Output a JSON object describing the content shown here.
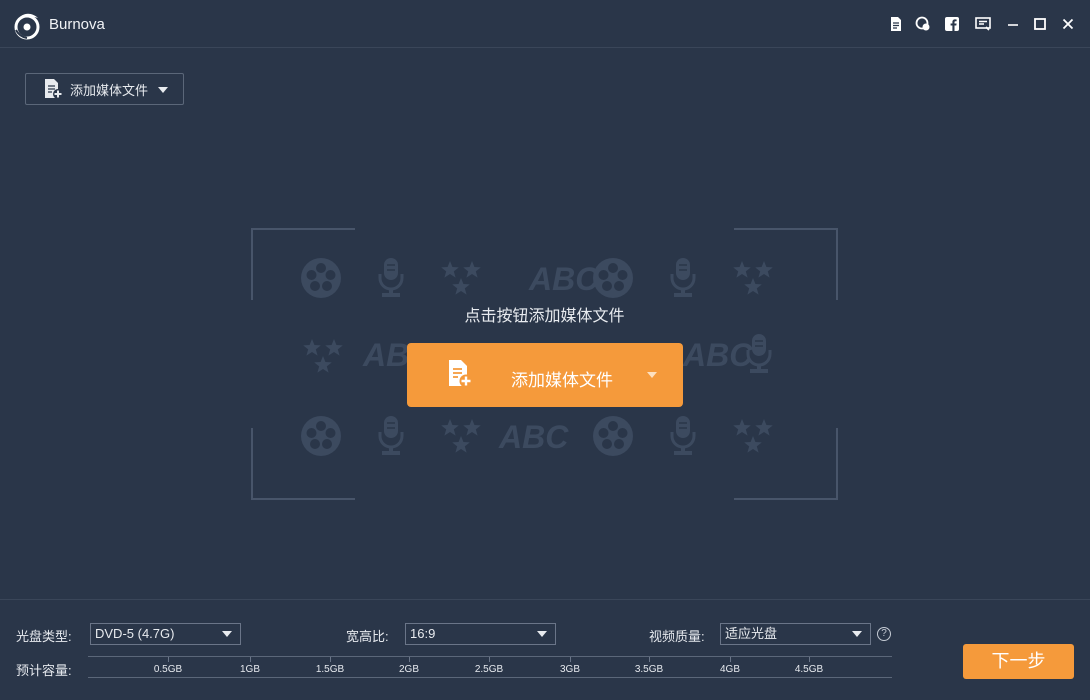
{
  "app": {
    "title": "Burnova"
  },
  "colors": {
    "background": "#2a3649",
    "accent": "#f59a3b",
    "pattern": "#3c4a5f"
  },
  "toolbar": {
    "icons": [
      "document-icon",
      "feedback-icon",
      "facebook-icon",
      "register-icon",
      "minimize-icon",
      "maximize-icon",
      "close-icon"
    ]
  },
  "add_media": {
    "label": "添加媒体文件"
  },
  "drop_zone": {
    "prompt": "点击按钮添加媒体文件",
    "button_label": "添加媒体文件",
    "pattern_text": "ABC"
  },
  "settings": {
    "disc_type": {
      "label": "光盘类型:",
      "value": "DVD-5 (4.7G)"
    },
    "aspect_ratio": {
      "label": "宽高比:",
      "value": "16:9"
    },
    "video_quality": {
      "label": "视频质量:",
      "value": "适应光盘"
    },
    "help": "?"
  },
  "capacity": {
    "label": "预计容量:",
    "ticks": [
      "0.5GB",
      "1GB",
      "1.5GB",
      "2GB",
      "2.5GB",
      "3GB",
      "3.5GB",
      "4GB",
      "4.5GB"
    ]
  },
  "next_button": {
    "label": "下一步"
  }
}
